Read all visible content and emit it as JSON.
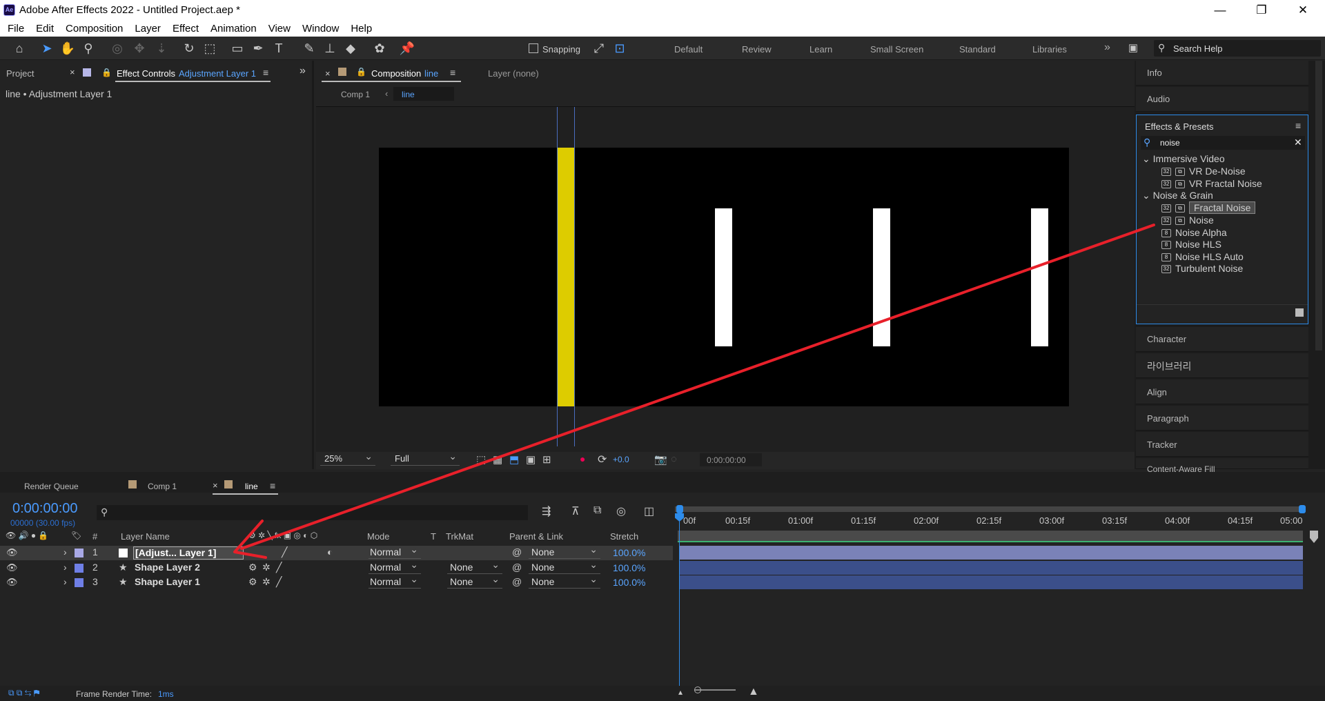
{
  "app": {
    "title": "Adobe After Effects 2022 - Untitled Project.aep *",
    "icon": "Ae",
    "window_controls": {
      "minimize": "—",
      "maximize": "❐",
      "close": "✕"
    }
  },
  "menu": [
    "File",
    "Edit",
    "Composition",
    "Layer",
    "Effect",
    "Animation",
    "View",
    "Window",
    "Help"
  ],
  "toolbar": {
    "snapping_label": "Snapping",
    "workspaces": [
      "Default",
      "Review",
      "Learn",
      "Small Screen",
      "Standard",
      "Libraries"
    ],
    "overflow": "»",
    "search_placeholder": "Search Help"
  },
  "left_panel": {
    "tab_project": "Project",
    "tab_effect_controls": "Effect Controls",
    "tab_effect_controls_target": "Adjustment Layer 1",
    "breadcrumb": "line • Adjustment Layer 1"
  },
  "composition": {
    "tab_label": "Composition",
    "tab_comp_name": "line",
    "layer_tab": "Layer (none)",
    "crumb_comp1": "Comp 1",
    "crumb_line": "line",
    "zoom": "25%",
    "resolution": "Full",
    "exposure": "+0.0",
    "timecode": "0:00:00:00"
  },
  "right_panel": {
    "info": "Info",
    "audio": "Audio",
    "effects_title": "Effects & Presets",
    "search_value": "noise",
    "groups": [
      {
        "name": "Immersive Video",
        "items": [
          "VR De-Noise",
          "VR Fractal Noise"
        ]
      },
      {
        "name": "Noise & Grain",
        "items": [
          "Fractal Noise",
          "Noise",
          "Noise Alpha",
          "Noise HLS",
          "Noise HLS Auto",
          "Turbulent Noise"
        ]
      }
    ],
    "character": "Character",
    "libraries_kr": "라이브러리",
    "align": "Align",
    "paragraph": "Paragraph",
    "tracker": "Tracker",
    "content_aware": "Content-Aware Fill"
  },
  "timeline": {
    "tabs": {
      "render_queue": "Render Queue",
      "comp1": "Comp 1",
      "line": "line"
    },
    "timecode": "0:00:00:00",
    "timecode_sub": "00000 (30.00 fps)",
    "columns": {
      "layer_name": "Layer Name",
      "hash": "#",
      "mode": "Mode",
      "t": "T",
      "trkmat": "TrkMat",
      "parent": "Parent & Link",
      "stretch": "Stretch"
    },
    "ruler": [
      "00f",
      "00:15f",
      "01:00f",
      "01:15f",
      "02:00f",
      "02:15f",
      "03:00f",
      "03:15f",
      "04:00f",
      "04:15f",
      "05:00"
    ],
    "layers": [
      {
        "num": "1",
        "name": "[Adjust... Layer 1]",
        "mode": "Normal",
        "trkmat": "",
        "parent": "None",
        "stretch": "100.0%",
        "color": "#a9a9e6"
      },
      {
        "num": "2",
        "name": "Shape Layer 2",
        "mode": "Normal",
        "trkmat": "None",
        "parent": "None",
        "stretch": "100.0%",
        "color": "#6f7fe6"
      },
      {
        "num": "3",
        "name": "Shape Layer 1",
        "mode": "Normal",
        "trkmat": "None",
        "parent": "None",
        "stretch": "100.0%",
        "color": "#6f7fe6"
      }
    ],
    "status_label": "Frame Render Time:",
    "status_value": "1ms"
  },
  "colors": {
    "accent": "#2d8ceb",
    "arrow": "#e8202a",
    "yellow_bar": "#ddcc00"
  }
}
